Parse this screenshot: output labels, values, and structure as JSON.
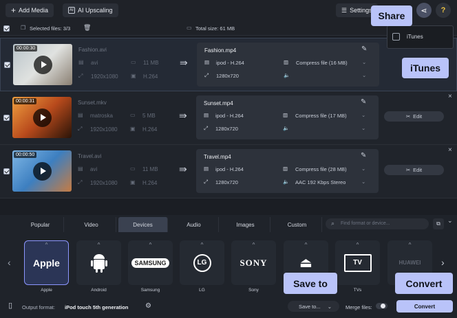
{
  "toolbar": {
    "add_media": "Add Media",
    "ai_upscaling": "AI Upscaling",
    "settings": "Settings"
  },
  "selection": {
    "selected": "Selected files: 3/3",
    "total": "Total size: 61 MB"
  },
  "files": [
    {
      "name": "Fashion.avi",
      "duration": "00:00:30",
      "format": "avi",
      "size": "11 MB",
      "resolution": "1920x1080",
      "codec": "H.264",
      "out_name": "Fashion.mp4",
      "out_codec": "ipod - H.264",
      "out_res": "1280x720",
      "compress": "Compress file (16 MB)",
      "audio": "",
      "colors": [
        "#b8c3c9",
        "#e0e2e0",
        "#8a7f72"
      ]
    },
    {
      "name": "Sunset.mkv",
      "duration": "00:00:31",
      "format": "matroska",
      "size": "5 MB",
      "resolution": "1920x1080",
      "codec": "H.264",
      "out_name": "Sunset.mp4",
      "out_codec": "ipod - H.264",
      "out_res": "1280x720",
      "compress": "Compress file (17 MB)",
      "audio": "",
      "colors": [
        "#f0a040",
        "#b84a1c",
        "#2a1408"
      ]
    },
    {
      "name": "Travel.avi",
      "duration": "00:00:50",
      "format": "avi",
      "size": "11 MB",
      "resolution": "1920x1080",
      "codec": "H.264",
      "out_name": "Travel.mp4",
      "out_codec": "ipod - H.264",
      "out_res": "1280x720",
      "compress": "Compress file (28 MB)",
      "audio": "AAC 192 Kbps Stereo",
      "colors": [
        "#7fb7e6",
        "#3d7fc0",
        "#c67c43"
      ]
    }
  ],
  "edit_label": "Edit",
  "tabs": [
    "Popular",
    "Video",
    "Devices",
    "Audio",
    "Images",
    "Custom"
  ],
  "active_tab": "Devices",
  "search_placeholder": "Find format or device...",
  "devices": [
    {
      "label": "Apple",
      "logo": "Apple"
    },
    {
      "label": "Android",
      "logo": ""
    },
    {
      "label": "Samsung",
      "logo": "SAMSUNG"
    },
    {
      "label": "LG",
      "logo": "LG"
    },
    {
      "label": "Sony",
      "logo": "SONY"
    },
    {
      "label": "",
      "logo": ""
    },
    {
      "label": "TVs",
      "logo": "TV"
    },
    {
      "label": "",
      "logo": "HUAWEI"
    }
  ],
  "footer": {
    "output_label": "Output format:",
    "output_value": "iPod touch 5th generation",
    "save_to": "Save to...",
    "merge": "Merge files:",
    "convert": "Convert"
  },
  "share_menu": {
    "item": "iTunes"
  },
  "tooltips": {
    "share": "Share",
    "itunes": "iTunes",
    "save_to": "Save to",
    "convert": "Convert"
  },
  "colors": {
    "accent": "#b9c3f9",
    "convert_button": "#b9c3f9"
  }
}
